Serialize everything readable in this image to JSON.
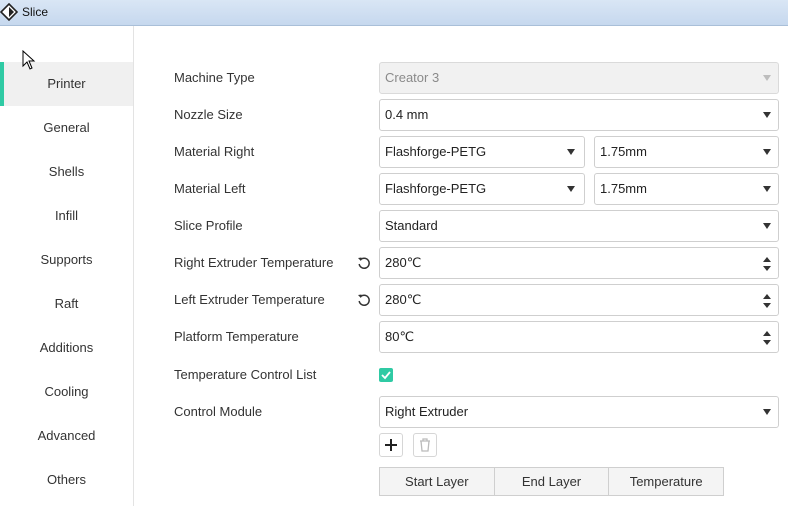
{
  "window": {
    "title": "Slice"
  },
  "sidebar": {
    "items": [
      {
        "label": "Printer",
        "active": true
      },
      {
        "label": "General"
      },
      {
        "label": "Shells"
      },
      {
        "label": "Infill"
      },
      {
        "label": "Supports"
      },
      {
        "label": "Raft"
      },
      {
        "label": "Additions"
      },
      {
        "label": "Cooling"
      },
      {
        "label": "Advanced"
      },
      {
        "label": "Others"
      }
    ]
  },
  "form": {
    "machine_type": {
      "label": "Machine Type",
      "value": "Creator 3"
    },
    "nozzle_size": {
      "label": "Nozzle Size",
      "value": "0.4 mm"
    },
    "material_right": {
      "label": "Material Right",
      "material": "Flashforge-PETG",
      "diameter": "1.75mm"
    },
    "material_left": {
      "label": "Material Left",
      "material": "Flashforge-PETG",
      "diameter": "1.75mm"
    },
    "slice_profile": {
      "label": "Slice Profile",
      "value": "Standard"
    },
    "right_extruder_temp": {
      "label": "Right Extruder Temperature",
      "value": "280℃"
    },
    "left_extruder_temp": {
      "label": "Left Extruder Temperature",
      "value": "280℃"
    },
    "platform_temp": {
      "label": "Platform Temperature",
      "value": "80℃"
    },
    "temp_control_list": {
      "label": "Temperature Control List",
      "checked": true
    },
    "control_module": {
      "label": "Control Module",
      "value": "Right Extruder"
    }
  },
  "table": {
    "columns": [
      "Start Layer",
      "End Layer",
      "Temperature"
    ]
  },
  "colors": {
    "accent": "#2fcaa4"
  }
}
